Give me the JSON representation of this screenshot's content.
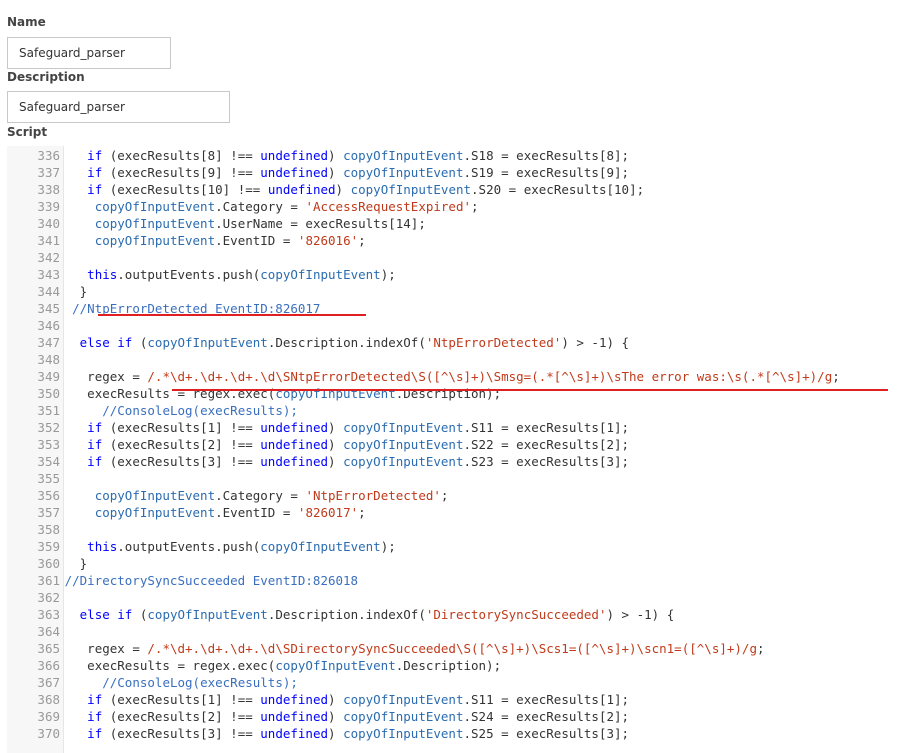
{
  "form": {
    "name_label": "Name",
    "name_value": "Safeguard_parser",
    "description_label": "Description",
    "description_value": "Safeguard_parser",
    "script_label": "Script"
  },
  "editor": {
    "lines": [
      {
        "num": "336",
        "indent": 6,
        "tokens": [
          {
            "t": "kw",
            "v": "if"
          },
          {
            "t": "p",
            "v": " (execResults[8] !== "
          },
          {
            "t": "kw",
            "v": "undefined"
          },
          {
            "t": "p",
            "v": ") "
          },
          {
            "t": "fn",
            "v": "copyOfInputEvent"
          },
          {
            "t": "p",
            "v": ".S18 = execResults[8];"
          }
        ]
      },
      {
        "num": "337",
        "indent": 6,
        "tokens": [
          {
            "t": "kw",
            "v": "if"
          },
          {
            "t": "p",
            "v": " (execResults[9] !== "
          },
          {
            "t": "kw",
            "v": "undefined"
          },
          {
            "t": "p",
            "v": ") "
          },
          {
            "t": "fn",
            "v": "copyOfInputEvent"
          },
          {
            "t": "p",
            "v": ".S19 = execResults[9];"
          }
        ]
      },
      {
        "num": "338",
        "indent": 6,
        "tokens": [
          {
            "t": "kw",
            "v": "if"
          },
          {
            "t": "p",
            "v": " (execResults[10] !== "
          },
          {
            "t": "kw",
            "v": "undefined"
          },
          {
            "t": "p",
            "v": ") "
          },
          {
            "t": "fn",
            "v": "copyOfInputEvent"
          },
          {
            "t": "p",
            "v": ".S20 = execResults[10];"
          }
        ]
      },
      {
        "num": "339",
        "indent": 7,
        "tokens": [
          {
            "t": "fn",
            "v": "copyOfInputEvent"
          },
          {
            "t": "p",
            "v": ".Category = "
          },
          {
            "t": "str",
            "v": "'AccessRequestExpired'"
          },
          {
            "t": "p",
            "v": ";"
          }
        ]
      },
      {
        "num": "340",
        "indent": 7,
        "tokens": [
          {
            "t": "fn",
            "v": "copyOfInputEvent"
          },
          {
            "t": "p",
            "v": ".UserName = execResults[14];"
          }
        ]
      },
      {
        "num": "341",
        "indent": 7,
        "tokens": [
          {
            "t": "fn",
            "v": "copyOfInputEvent"
          },
          {
            "t": "p",
            "v": ".EventID = "
          },
          {
            "t": "str",
            "v": "'826016'"
          },
          {
            "t": "p",
            "v": ";"
          }
        ]
      },
      {
        "num": "342",
        "indent": 0,
        "tokens": []
      },
      {
        "num": "343",
        "indent": 6,
        "tokens": [
          {
            "t": "kw",
            "v": "this"
          },
          {
            "t": "p",
            "v": ".outputEvents.push("
          },
          {
            "t": "fn",
            "v": "copyOfInputEvent"
          },
          {
            "t": "p",
            "v": ");"
          }
        ]
      },
      {
        "num": "344",
        "indent": 5,
        "tokens": [
          {
            "t": "p",
            "v": "}"
          }
        ]
      },
      {
        "num": "345",
        "indent": 4,
        "tokens": [
          {
            "t": "cm",
            "v": "//NtpErrorDetected EventID:826017"
          }
        ]
      },
      {
        "num": "346",
        "indent": 0,
        "tokens": []
      },
      {
        "num": "347",
        "indent": 5,
        "tokens": [
          {
            "t": "kw",
            "v": "else if"
          },
          {
            "t": "p",
            "v": " ("
          },
          {
            "t": "fn",
            "v": "copyOfInputEvent"
          },
          {
            "t": "p",
            "v": ".Description.indexOf("
          },
          {
            "t": "str",
            "v": "'NtpErrorDetected'"
          },
          {
            "t": "p",
            "v": ") > -1) {"
          }
        ]
      },
      {
        "num": "348",
        "indent": 0,
        "tokens": []
      },
      {
        "num": "349",
        "indent": 6,
        "tokens": [
          {
            "t": "p",
            "v": "regex = "
          },
          {
            "t": "str",
            "v": "/.*\\d+.\\d+.\\d+.\\d\\SNtpErrorDetected\\S([^\\s]+)\\Smsg=(.*[^\\s]+)\\sThe error was:\\s(.*[^\\s]+)/g"
          },
          {
            "t": "p",
            "v": ";"
          }
        ]
      },
      {
        "num": "350",
        "indent": 6,
        "tokens": [
          {
            "t": "p",
            "v": "execResults = regex.exec("
          },
          {
            "t": "fn",
            "v": "copyOfInputEvent"
          },
          {
            "t": "p",
            "v": ".Description);"
          }
        ]
      },
      {
        "num": "351",
        "indent": 8,
        "tokens": [
          {
            "t": "cm",
            "v": "//ConsoleLog(execResults);"
          }
        ]
      },
      {
        "num": "352",
        "indent": 6,
        "tokens": [
          {
            "t": "kw",
            "v": "if"
          },
          {
            "t": "p",
            "v": " (execResults[1] !== "
          },
          {
            "t": "kw",
            "v": "undefined"
          },
          {
            "t": "p",
            "v": ") "
          },
          {
            "t": "fn",
            "v": "copyOfInputEvent"
          },
          {
            "t": "p",
            "v": ".S11 = execResults[1];"
          }
        ]
      },
      {
        "num": "353",
        "indent": 6,
        "tokens": [
          {
            "t": "kw",
            "v": "if"
          },
          {
            "t": "p",
            "v": " (execResults[2] !== "
          },
          {
            "t": "kw",
            "v": "undefined"
          },
          {
            "t": "p",
            "v": ") "
          },
          {
            "t": "fn",
            "v": "copyOfInputEvent"
          },
          {
            "t": "p",
            "v": ".S22 = execResults[2];"
          }
        ]
      },
      {
        "num": "354",
        "indent": 6,
        "tokens": [
          {
            "t": "kw",
            "v": "if"
          },
          {
            "t": "p",
            "v": " (execResults[3] !== "
          },
          {
            "t": "kw",
            "v": "undefined"
          },
          {
            "t": "p",
            "v": ") "
          },
          {
            "t": "fn",
            "v": "copyOfInputEvent"
          },
          {
            "t": "p",
            "v": ".S23 = execResults[3];"
          }
        ]
      },
      {
        "num": "355",
        "indent": 0,
        "tokens": []
      },
      {
        "num": "356",
        "indent": 7,
        "tokens": [
          {
            "t": "fn",
            "v": "copyOfInputEvent"
          },
          {
            "t": "p",
            "v": ".Category = "
          },
          {
            "t": "str",
            "v": "'NtpErrorDetected'"
          },
          {
            "t": "p",
            "v": ";"
          }
        ]
      },
      {
        "num": "357",
        "indent": 7,
        "tokens": [
          {
            "t": "fn",
            "v": "copyOfInputEvent"
          },
          {
            "t": "p",
            "v": ".EventID = "
          },
          {
            "t": "str",
            "v": "'826017'"
          },
          {
            "t": "p",
            "v": ";"
          }
        ]
      },
      {
        "num": "358",
        "indent": 0,
        "tokens": []
      },
      {
        "num": "359",
        "indent": 6,
        "tokens": [
          {
            "t": "kw",
            "v": "this"
          },
          {
            "t": "p",
            "v": ".outputEvents.push("
          },
          {
            "t": "fn",
            "v": "copyOfInputEvent"
          },
          {
            "t": "p",
            "v": ");"
          }
        ]
      },
      {
        "num": "360",
        "indent": 5,
        "tokens": [
          {
            "t": "p",
            "v": "}"
          }
        ]
      },
      {
        "num": "361",
        "indent": 3,
        "tokens": [
          {
            "t": "cm",
            "v": "//DirectorySyncSucceeded EventID:826018"
          }
        ]
      },
      {
        "num": "362",
        "indent": 0,
        "tokens": []
      },
      {
        "num": "363",
        "indent": 5,
        "tokens": [
          {
            "t": "kw",
            "v": "else if"
          },
          {
            "t": "p",
            "v": " ("
          },
          {
            "t": "fn",
            "v": "copyOfInputEvent"
          },
          {
            "t": "p",
            "v": ".Description.indexOf("
          },
          {
            "t": "str",
            "v": "'DirectorySyncSucceeded'"
          },
          {
            "t": "p",
            "v": ") > -1) {"
          }
        ]
      },
      {
        "num": "364",
        "indent": 0,
        "tokens": []
      },
      {
        "num": "365",
        "indent": 6,
        "tokens": [
          {
            "t": "p",
            "v": "regex = "
          },
          {
            "t": "str",
            "v": "/.*\\d+.\\d+.\\d+.\\d\\SDirectorySyncSucceeded\\S([^\\s]+)\\Scs1=([^\\s]+)\\scn1=([^\\s]+)/g"
          },
          {
            "t": "p",
            "v": ";"
          }
        ]
      },
      {
        "num": "366",
        "indent": 6,
        "tokens": [
          {
            "t": "p",
            "v": "execResults = regex.exec("
          },
          {
            "t": "fn",
            "v": "copyOfInputEvent"
          },
          {
            "t": "p",
            "v": ".Description);"
          }
        ]
      },
      {
        "num": "367",
        "indent": 8,
        "tokens": [
          {
            "t": "cm",
            "v": "//ConsoleLog(execResults);"
          }
        ]
      },
      {
        "num": "368",
        "indent": 6,
        "tokens": [
          {
            "t": "kw",
            "v": "if"
          },
          {
            "t": "p",
            "v": " (execResults[1] !== "
          },
          {
            "t": "kw",
            "v": "undefined"
          },
          {
            "t": "p",
            "v": ") "
          },
          {
            "t": "fn",
            "v": "copyOfInputEvent"
          },
          {
            "t": "p",
            "v": ".S11 = execResults[1];"
          }
        ]
      },
      {
        "num": "369",
        "indent": 6,
        "tokens": [
          {
            "t": "kw",
            "v": "if"
          },
          {
            "t": "p",
            "v": " (execResults[2] !== "
          },
          {
            "t": "kw",
            "v": "undefined"
          },
          {
            "t": "p",
            "v": ") "
          },
          {
            "t": "fn",
            "v": "copyOfInputEvent"
          },
          {
            "t": "p",
            "v": ".S24 = execResults[2];"
          }
        ]
      },
      {
        "num": "370",
        "indent": 6,
        "tokens": [
          {
            "t": "kw",
            "v": "if"
          },
          {
            "t": "p",
            "v": " (execResults[3] !== "
          },
          {
            "t": "kw",
            "v": "undefined"
          },
          {
            "t": "p",
            "v": ") "
          },
          {
            "t": "fn",
            "v": "copyOfInputEvent"
          },
          {
            "t": "p",
            "v": ".S25 = execResults[3];"
          }
        ]
      }
    ]
  },
  "colors": {
    "keyword": "#0000ff",
    "identifier": "#2b6cb0",
    "string": "#c03a1b",
    "comment": "#3a6fbf",
    "annotation_underline": "#e02020"
  }
}
